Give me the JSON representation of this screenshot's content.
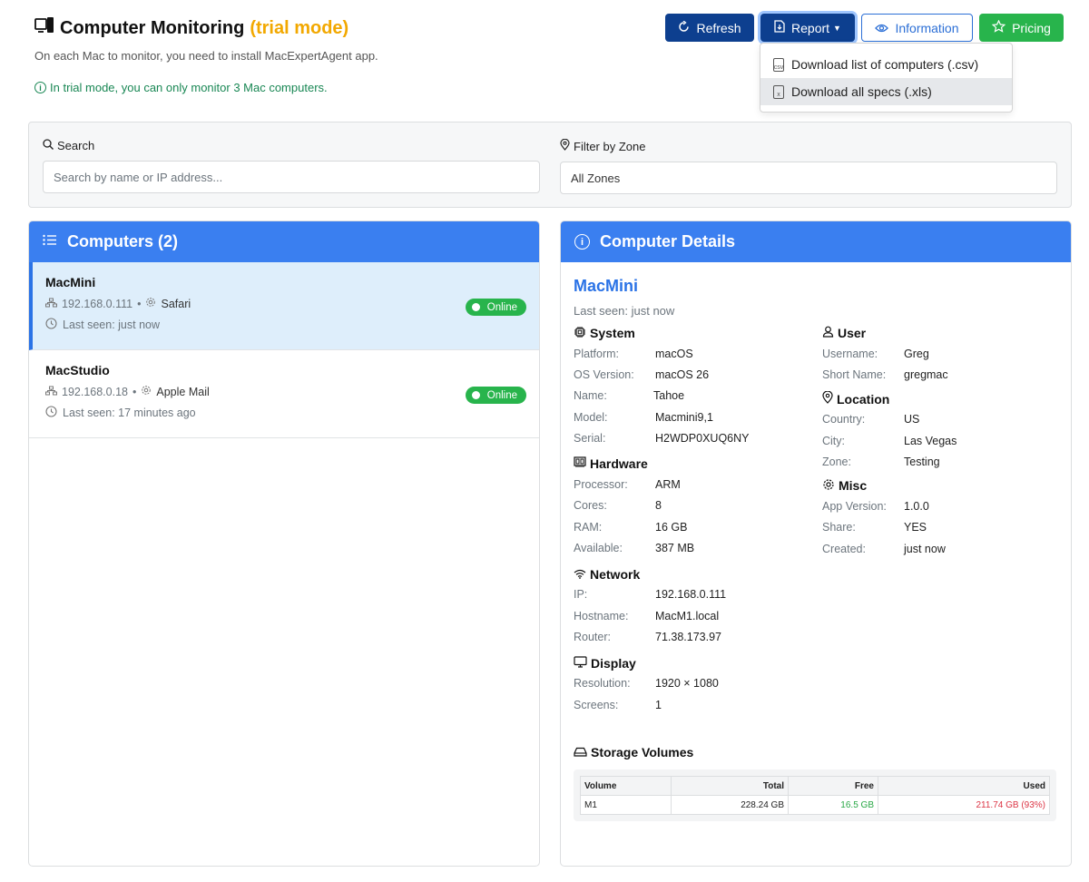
{
  "header": {
    "title": "Computer Monitoring",
    "trial_label": "(trial mode)",
    "subtitle": "On each Mac to monitor, you need to install MacExpertAgent app.",
    "trial_note": "In trial mode, you can only monitor 3 Mac computers."
  },
  "toolbar": {
    "refresh": "Refresh",
    "report": "Report",
    "information": "Information",
    "pricing": "Pricing"
  },
  "report_menu": {
    "items": [
      {
        "label": "Download list of computers (.csv)"
      },
      {
        "label": "Download all specs (.xls)"
      }
    ]
  },
  "filters": {
    "search_label": "Search",
    "search_placeholder": "Search by name or IP address...",
    "zone_label": "Filter by Zone",
    "zone_value": "All Zones"
  },
  "computers": {
    "title": "Computers (2)",
    "items": [
      {
        "name": "MacMini",
        "ip": "192.168.0.111",
        "sep": "•",
        "app": "Safari",
        "last_seen": "Last seen: just now",
        "status": "Online"
      },
      {
        "name": "MacStudio",
        "ip": "192.168.0.18",
        "sep": "•",
        "app": "Apple Mail",
        "last_seen": "Last seen: 17 minutes ago",
        "status": "Online"
      }
    ]
  },
  "details": {
    "title": "Computer Details",
    "name": "MacMini",
    "last_seen": "Last seen: just now",
    "system": {
      "title": "System",
      "rows": [
        {
          "k": "Platform:",
          "v": "macOS"
        },
        {
          "k": "OS Version:",
          "v": "macOS 26"
        },
        {
          "k": "Name:",
          "v": "Tahoe"
        },
        {
          "k": "Model:",
          "v": "Macmini9,1"
        },
        {
          "k": "Serial:",
          "v": "H2WDP0XUQ6NY"
        }
      ]
    },
    "hardware": {
      "title": "Hardware",
      "rows": [
        {
          "k": "Processor:",
          "v": "ARM"
        },
        {
          "k": "Cores:",
          "v": "8"
        },
        {
          "k": "RAM:",
          "v": "16 GB"
        },
        {
          "k": "Available:",
          "v": "387 MB"
        }
      ]
    },
    "network": {
      "title": "Network",
      "rows": [
        {
          "k": "IP:",
          "v": "192.168.0.111"
        },
        {
          "k": "Hostname:",
          "v": "MacM1.local"
        },
        {
          "k": "Router:",
          "v": "71.38.173.97"
        }
      ]
    },
    "display": {
      "title": "Display",
      "rows": [
        {
          "k": "Resolution:",
          "v": "1920 × 1080"
        },
        {
          "k": "Screens:",
          "v": "1"
        }
      ]
    },
    "user": {
      "title": "User",
      "rows": [
        {
          "k": "Username:",
          "v": "Greg"
        },
        {
          "k": "Short Name:",
          "v": "gregmac"
        }
      ]
    },
    "location": {
      "title": "Location",
      "rows": [
        {
          "k": "Country:",
          "v": "US"
        },
        {
          "k": "City:",
          "v": "Las Vegas"
        },
        {
          "k": "Zone:",
          "v": "Testing"
        }
      ]
    },
    "misc": {
      "title": "Misc",
      "rows": [
        {
          "k": "App Version:",
          "v": "1.0.0"
        },
        {
          "k": "Share:",
          "v": "YES"
        },
        {
          "k": "Created:",
          "v": "just now"
        }
      ]
    },
    "storage": {
      "title": "Storage Volumes",
      "columns": [
        "Volume",
        "Total",
        "Free",
        "Used"
      ],
      "rows": [
        {
          "volume": "M1",
          "total": "228.24 GB",
          "free": "16.5 GB",
          "used": "211.74 GB (93%)"
        }
      ]
    }
  },
  "colors": {
    "primary_dark": "#0d3f8f",
    "panel_header": "#3a7ff0",
    "online": "#28b44c",
    "trial": "#f2a800",
    "free": "#28a745",
    "used": "#dc3545"
  }
}
